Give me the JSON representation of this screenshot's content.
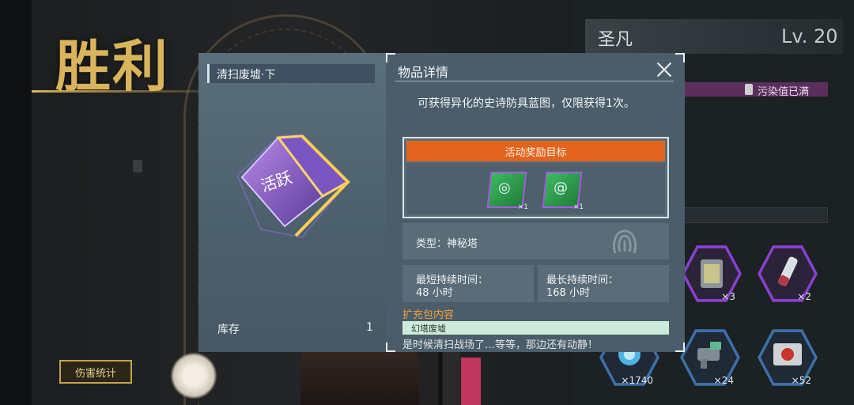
{
  "victory": {
    "title": "胜利",
    "damage_stats_button": "伤害统计"
  },
  "item": {
    "name": "清扫废墟·下",
    "art_text": "活跃",
    "stock_label": "库存",
    "stock_value": "1"
  },
  "detail": {
    "title": "物品详情",
    "description": "可获得异化的史诗防具蓝图，仅限获得1次。",
    "target_header": "活动奖励目标",
    "blueprints": [
      {
        "name": "blueprint-ring",
        "count": "×1"
      },
      {
        "name": "blueprint-swirl",
        "count": "×1"
      }
    ],
    "type_text": "类型：神秘塔",
    "min_duration_label": "最短持续时间：",
    "min_duration_value": "48 小时",
    "max_duration_label": "最长持续时间：",
    "max_duration_value": "168 小时",
    "pack_title": "扩充包内容",
    "pack_items": [
      "幻塔废墟"
    ],
    "flavor_text": "是时候清扫战场了…等等，那边还有动静！"
  },
  "player": {
    "name": "圣凡",
    "level": "Lv. 20",
    "status": "污染值已满"
  },
  "rewards": [
    {
      "name": "battery-pack",
      "count": "×3",
      "color": "#8a3fd0"
    },
    {
      "name": "syringe",
      "count": "×2",
      "color": "#8a3fd0"
    },
    {
      "name": "core-orb",
      "count": "×1740",
      "color": "#3b6fa8"
    },
    {
      "name": "turret-part",
      "count": "×24",
      "color": "#3b6fa8"
    },
    {
      "name": "fuel-kit",
      "count": "×52",
      "color": "#3b6fa8"
    }
  ]
}
